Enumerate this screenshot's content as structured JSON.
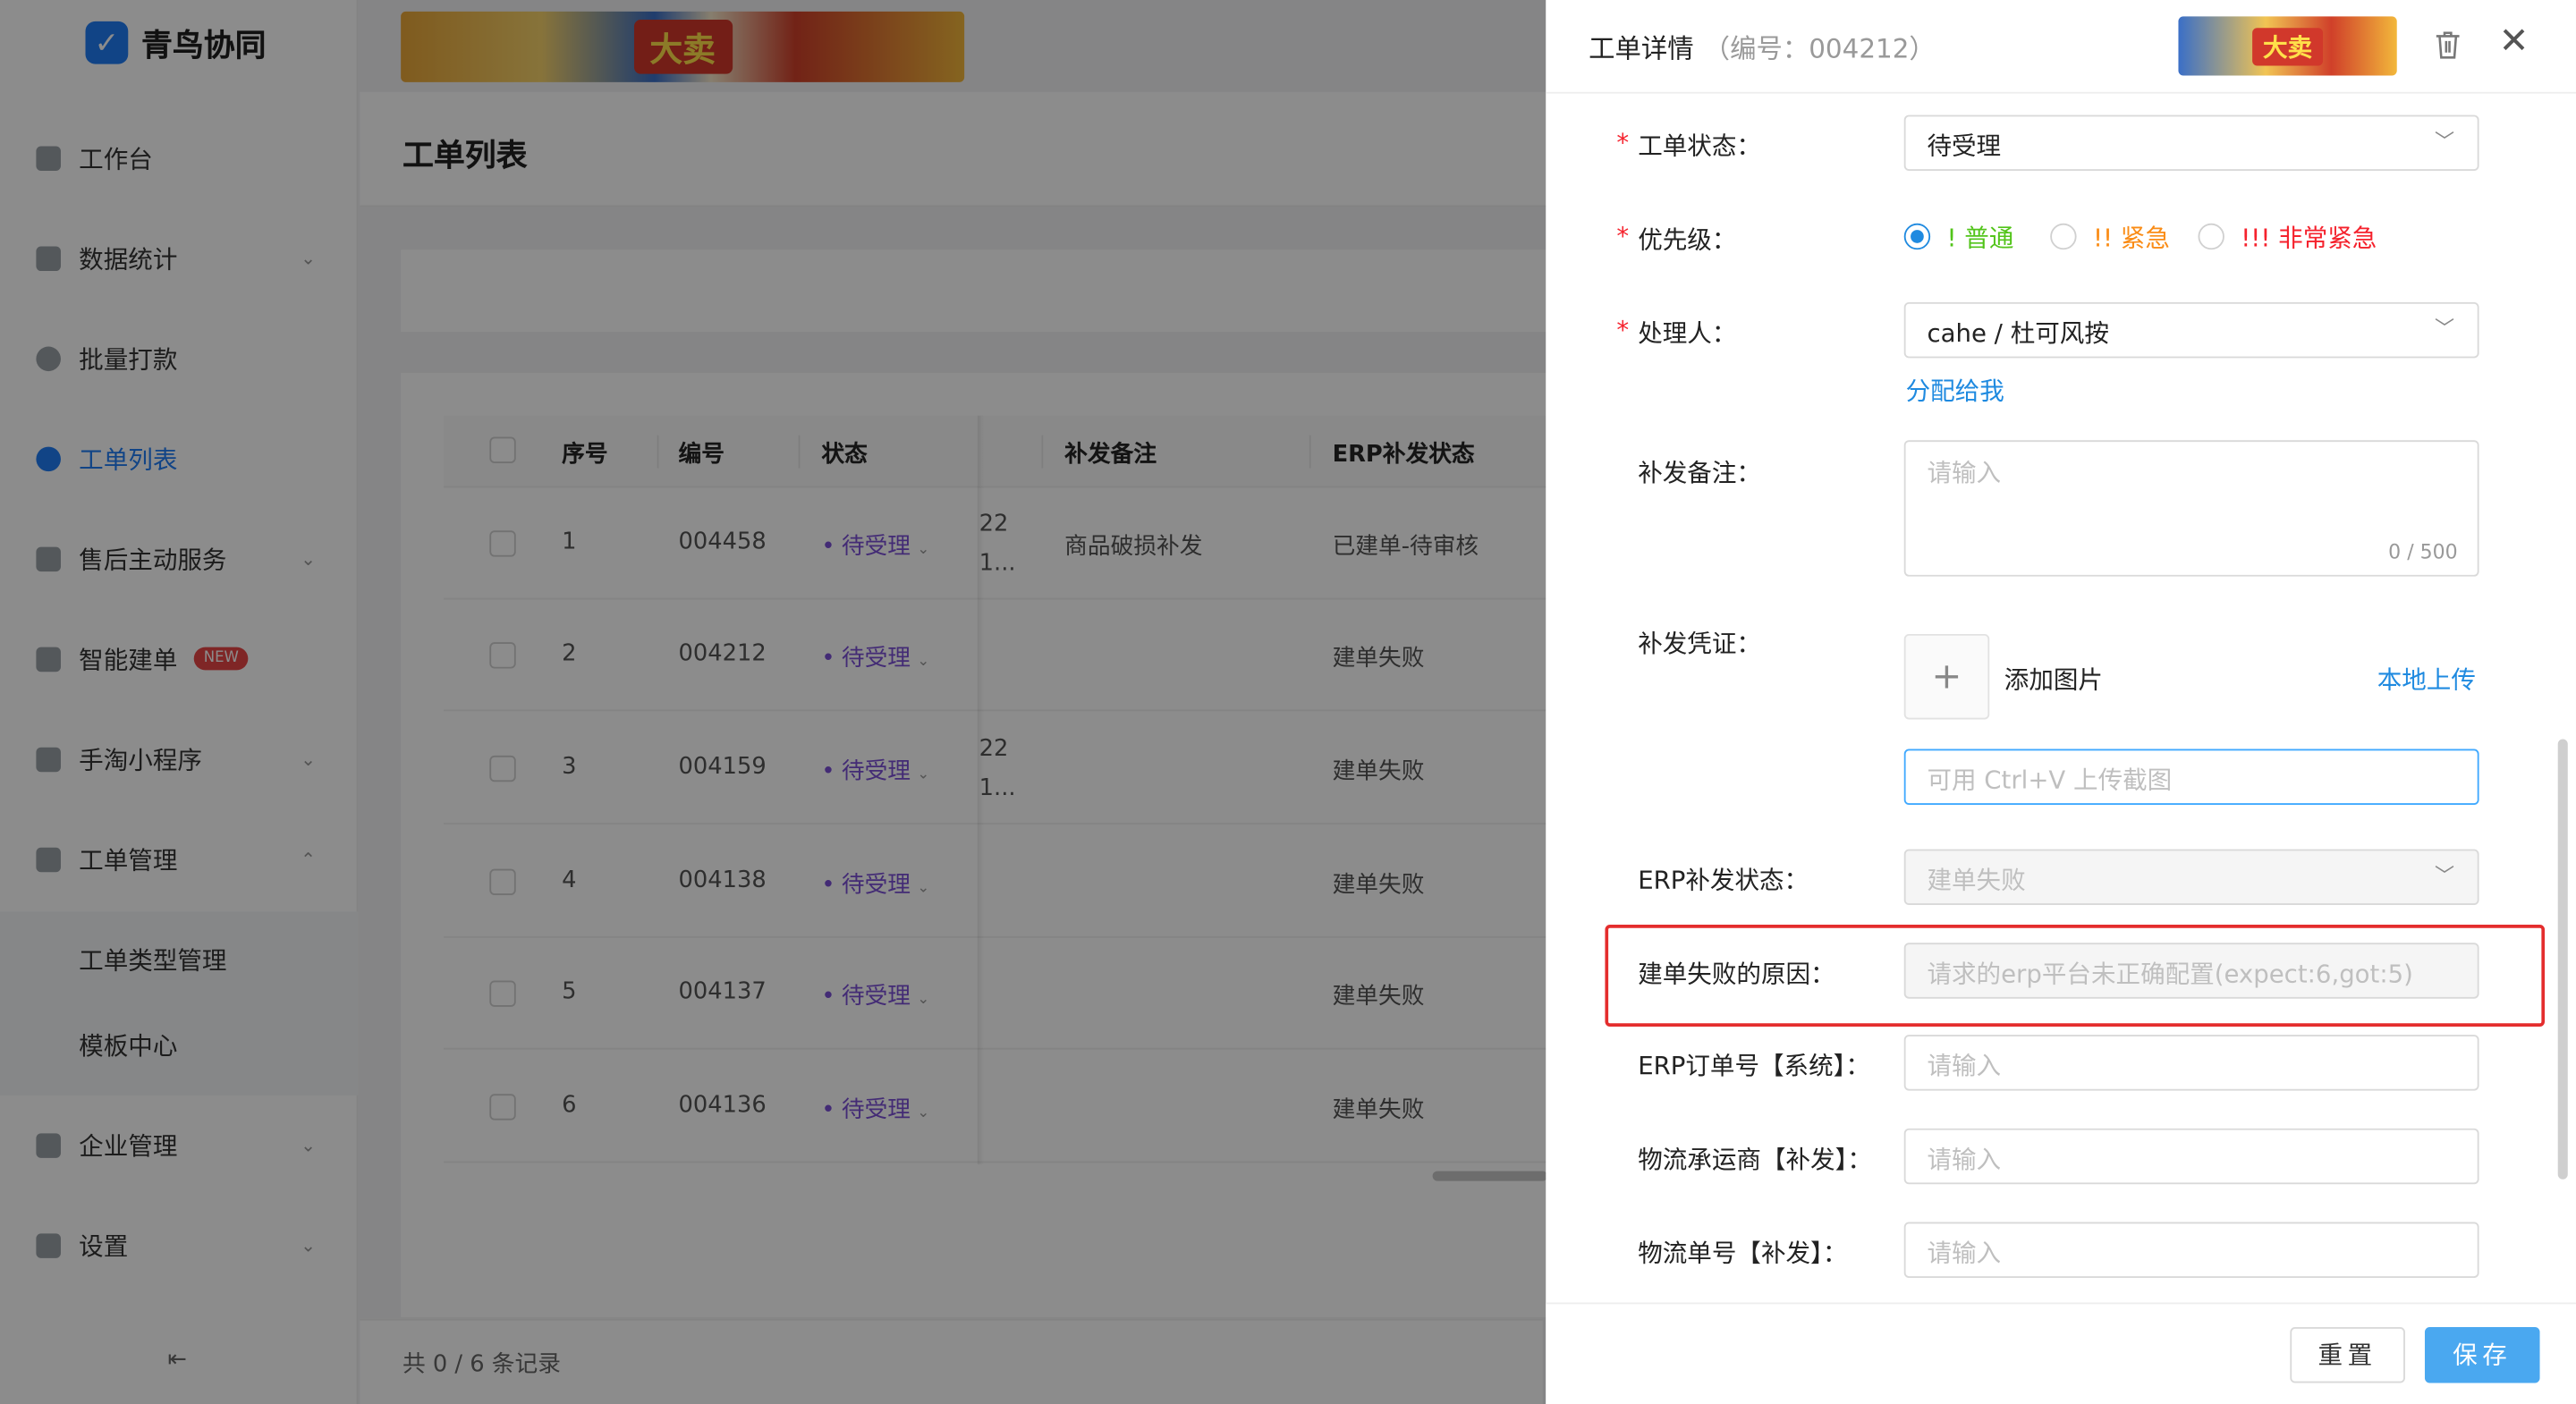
{
  "app": {
    "name": "青鸟协同"
  },
  "banner": {
    "text": "大卖"
  },
  "sidebar": {
    "items": [
      {
        "label": "工作台",
        "icon": "monitor-icon",
        "chevron": ""
      },
      {
        "label": "数据统计",
        "icon": "bar-chart-icon",
        "chevron": "⌄"
      },
      {
        "label": "批量打款",
        "icon": "coin-icon",
        "chevron": ""
      },
      {
        "label": "工单列表",
        "icon": "search-icon",
        "chevron": "",
        "active": true
      },
      {
        "label": "售后主动服务",
        "icon": "chat-icon",
        "chevron": "⌄"
      },
      {
        "label": "智能建单",
        "icon": "document-icon",
        "chevron": "",
        "badge": "NEW"
      },
      {
        "label": "手淘小程序",
        "icon": "clipboard-icon",
        "chevron": "⌄"
      },
      {
        "label": "工单管理",
        "icon": "edit-icon",
        "chevron": "⌃"
      },
      {
        "label": "工单类型管理",
        "sub": true
      },
      {
        "label": "模板中心",
        "sub": true
      },
      {
        "label": "企业管理",
        "icon": "building-icon",
        "chevron": "⌄"
      },
      {
        "label": "设置",
        "icon": "settings-icon",
        "chevron": "⌄"
      }
    ],
    "collapse_icon": "⇤"
  },
  "main": {
    "title": "工单列表",
    "table": {
      "headers": [
        "序号",
        "编号",
        "状态",
        "补发备注",
        "ERP补发状态"
      ],
      "rows": [
        {
          "index": "1",
          "code": "004458",
          "status": "待受理",
          "trunc": "22\n1...",
          "remark": "商品破损补发",
          "erp_status": "已建单-待审核"
        },
        {
          "index": "2",
          "code": "004212",
          "status": "待受理",
          "trunc": "",
          "remark": "",
          "erp_status": "建单失败"
        },
        {
          "index": "3",
          "code": "004159",
          "status": "待受理",
          "trunc": "22\n1...",
          "remark": "",
          "erp_status": "建单失败"
        },
        {
          "index": "4",
          "code": "004138",
          "status": "待受理",
          "trunc": "",
          "remark": "",
          "erp_status": "建单失败"
        },
        {
          "index": "5",
          "code": "004137",
          "status": "待受理",
          "trunc": "",
          "remark": "",
          "erp_status": "建单失败"
        },
        {
          "index": "6",
          "code": "004136",
          "status": "待受理",
          "trunc": "",
          "remark": "",
          "erp_status": "建单失败"
        }
      ]
    },
    "total_text": "共 0 / 6 条记录"
  },
  "drawer": {
    "title": "工单详情",
    "subtitle": "（编号：004212）",
    "fields": {
      "status_label": "工单状态：",
      "status_value": "待受理",
      "priority_label": "优先级：",
      "priority_options": [
        {
          "label": "! 普通",
          "color": "#52c41a",
          "checked": true
        },
        {
          "label": "!! 紧急",
          "color": "#fa8c16",
          "checked": false
        },
        {
          "label": "!!! 非常紧急",
          "color": "#f5222d",
          "checked": false
        }
      ],
      "handler_label": "处理人：",
      "handler_value": "cahe / 杜可风按",
      "assign_me": "分配给我",
      "remark_label": "补发备注：",
      "remark_placeholder": "请输入",
      "remark_counter": "0 / 500",
      "proof_label": "补发凭证：",
      "add_image": "添加图片",
      "local_upload": "本地上传",
      "paste_placeholder": "可用 Ctrl+V 上传截图",
      "erp_status_label": "ERP补发状态：",
      "erp_status_value": "建单失败",
      "fail_reason_label": "建单失败的原因：",
      "fail_reason_value": "请求的erp平台未正确配置(expect:6,got:5)",
      "erp_order_label": "ERP订单号【系统】：",
      "erp_order_placeholder": "请输入",
      "carrier_label": "物流承运商【补发】：",
      "carrier_placeholder": "请输入",
      "tracking_label": "物流单号【补发】：",
      "tracking_placeholder": "请输入"
    },
    "buttons": {
      "reset": "重置",
      "save": "保存"
    }
  },
  "colors": {
    "accent": "#1f8ae0",
    "status_purple": "#7b4fd6",
    "highlight_red": "#e42d2d"
  }
}
